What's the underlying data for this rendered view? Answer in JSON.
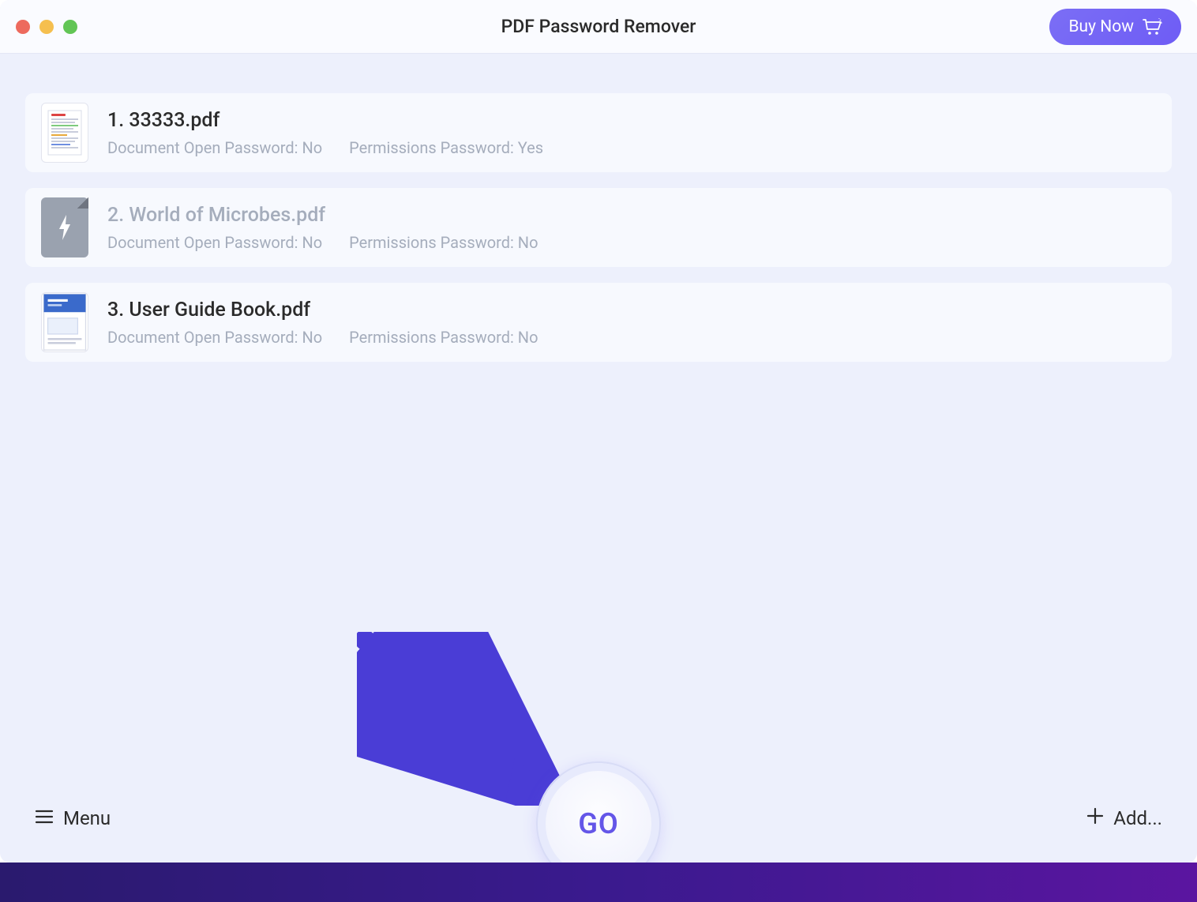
{
  "header": {
    "title": "PDF Password Remover",
    "buy_now_label": "Buy Now"
  },
  "files": [
    {
      "name": "1. 33333.pdf",
      "doc_open_label": "Document Open Password: No",
      "permissions_label": "Permissions Password: Yes",
      "thumb": "doc",
      "dim": false
    },
    {
      "name": "2. World of Microbes.pdf",
      "doc_open_label": "Document Open Password: No",
      "permissions_label": "Permissions Password: No",
      "thumb": "bolt",
      "dim": true
    },
    {
      "name": "3. User Guide Book.pdf",
      "doc_open_label": "Document Open Password: No",
      "permissions_label": "Permissions Password: No",
      "thumb": "blue",
      "dim": false
    }
  ],
  "footer": {
    "menu_label": "Menu",
    "add_label": "Add...",
    "go_label": "GO"
  }
}
